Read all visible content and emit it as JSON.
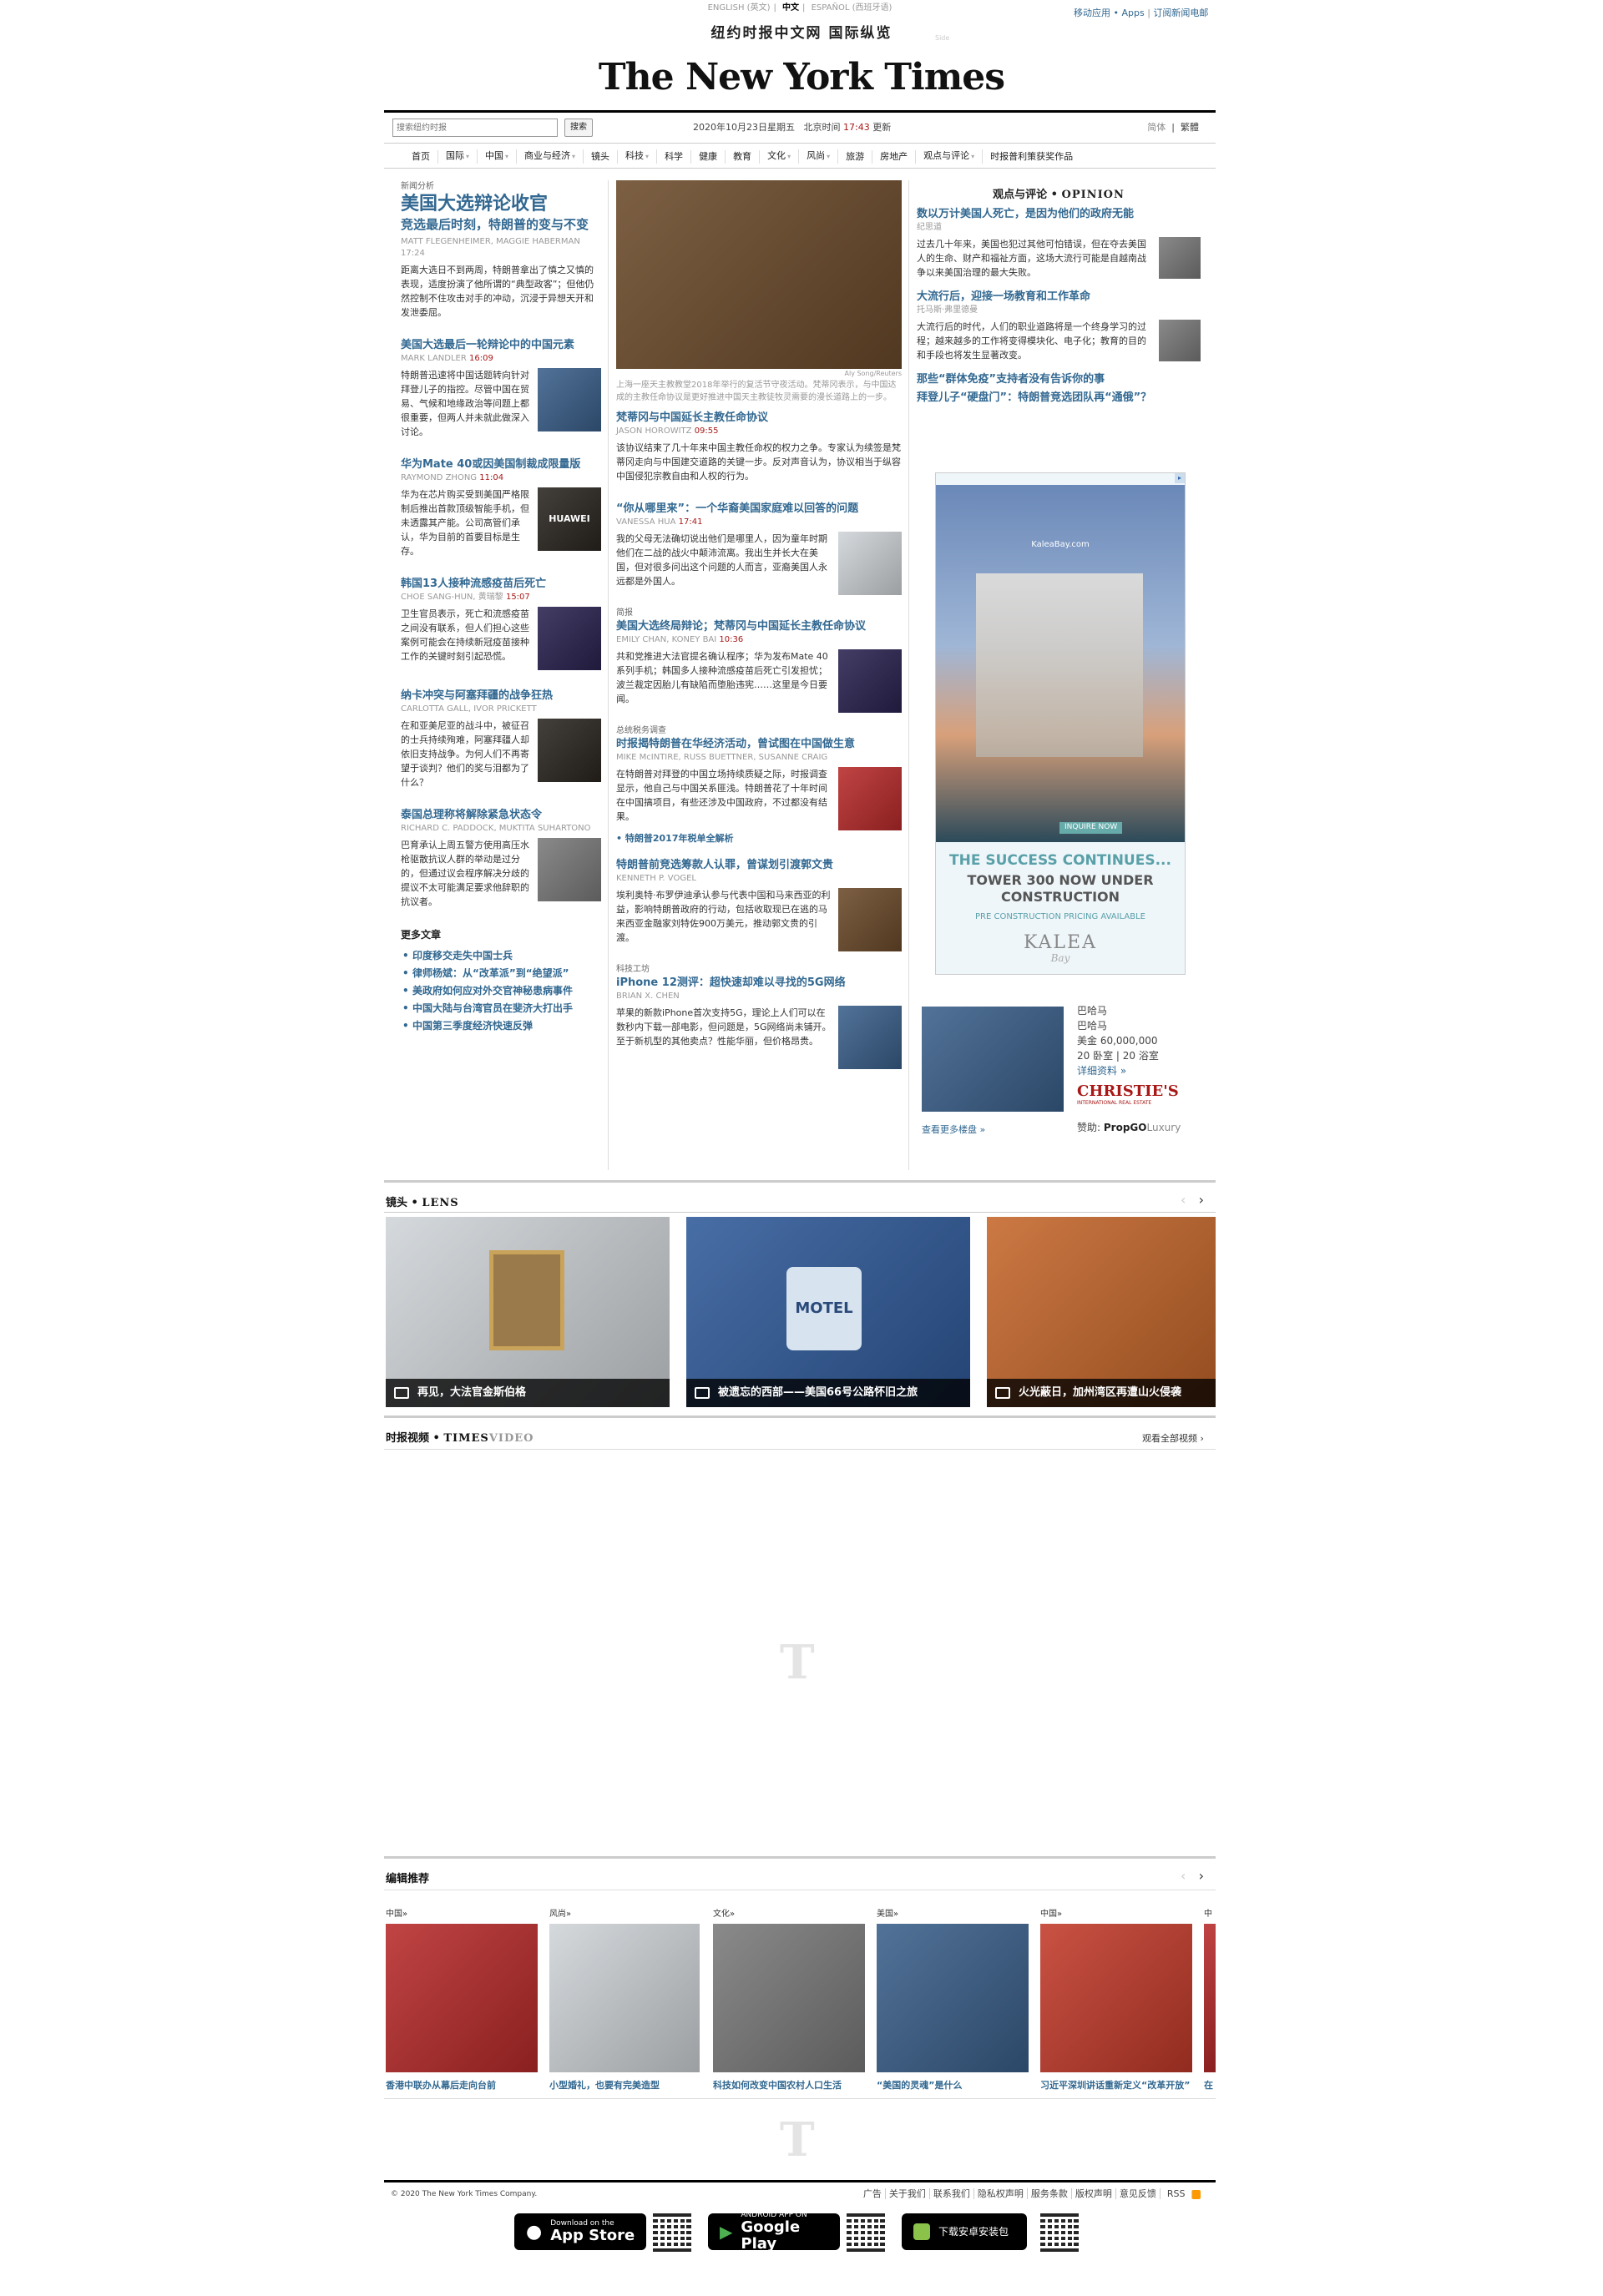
{
  "lang": {
    "english": "ENGLISH (英文)",
    "chinese": "中文",
    "spanish": "ESPAÑOL (西班牙语)"
  },
  "top_right": {
    "apps": "移动应用 • Apps",
    "sep": "|",
    "subscribe": "订阅新闻电邮"
  },
  "site_subtitle": "纽约时报中文网 国际纵览",
  "side_label": "Side",
  "logo": "The New York Times",
  "search": {
    "placeholder": "搜索纽约时报",
    "button": "搜索"
  },
  "dateline": {
    "date": "2020年10月23日星期五",
    "beijing": "北京时间",
    "time": "17:43",
    "update": "更新"
  },
  "scripts": {
    "simplified": "简体",
    "sep": "|",
    "traditional": "繁體"
  },
  "nav": [
    "首页",
    "国际",
    "中国",
    "商业与经济",
    "镜头",
    "科技",
    "科学",
    "健康",
    "教育",
    "文化",
    "风尚",
    "旅游",
    "房地产",
    "观点与评论",
    "时报普利策获奖作品"
  ],
  "col1": {
    "lead_kicker": "新闻分析",
    "lead_title": "美国大选辩论收官",
    "lead_sub": "竞选最后时刻，特朗普的变与不变",
    "lead_byline": "MATT FLEGENHEIMER, MAGGIE HABERMAN",
    "lead_time": "17:24",
    "lead_text": "距离大选日不到两周，特朗普拿出了慎之又慎的表现，适度扮演了他所谓的“典型政客”；但他仍然控制不住攻击对手的冲动，沉浸于异想天开和发泄委屈。",
    "s2": {
      "title": "美国大选最后一轮辩论中的中国元素",
      "byline": "MARK LANDLER",
      "time": "16:09",
      "text": "特朗普迅速将中国话题转向针对拜登儿子的指控。尽管中国在贸易、气候和地缘政治等问题上都很重要，但两人并未就此做深入讨论。"
    },
    "s3": {
      "title": "华为Mate 40或因美国制裁成限量版",
      "byline": "RAYMOND ZHONG",
      "time": "11:04",
      "text": "华为在芯片购买受到美国严格限制后推出首款顶级智能手机，但未透露其产能。公司高管们承认，华为目前的首要目标是生存。",
      "thumb_label": "HUAWEI"
    },
    "s4": {
      "title": "韩国13人接种流感疫苗后死亡",
      "byline": "CHOE SANG-HUN, 黄瑞黎",
      "time": "15:07",
      "text": "卫生官员表示，死亡和流感疫苗之间没有联系，但人们担心这些案例可能会在持续新冠疫苗接种工作的关键时刻引起恐慌。"
    },
    "s5": {
      "title": "纳卡冲突与阿塞拜疆的战争狂热",
      "byline": "CARLOTTA GALL, IVOR PRICKETT",
      "text": "在和亚美尼亚的战斗中，被征召的士兵持续殉难，阿塞拜疆人却依旧支持战争。为何人们不再寄望于谈判？他们的奖与泪都为了什么？"
    },
    "s6": {
      "title": "泰国总理称将解除紧急状态令",
      "byline": "RICHARD C. PADDOCK, MUKTITA SUHARTONO",
      "text": "巴育承认上周五警方使用高压水枪驱散抗议人群的举动是过分的，但通过议会程序解决分歧的提议不太可能满足要求他辞职的抗议者。"
    },
    "more_title": "更多文章",
    "more": [
      "印度移交走失中国士兵",
      "律师杨斌：从“改革派”到“绝望派”",
      "美政府如何应对外交官神秘患病事件",
      "中国大陆与台湾官员在斐济大打出手",
      "中国第三季度经济快速反弹"
    ]
  },
  "col2": {
    "photo_credit": "Aly Song/Reuters",
    "photo_caption": "上海一座天主教教堂2018年举行的复活节守夜活动。梵蒂冈表示，与中国达成的主教任命协议是更好推进中国天主教徒牧灵需要的漫长道路上的一步。",
    "s1": {
      "title": "梵蒂冈与中国延长主教任命协议",
      "byline": "JASON HOROWITZ",
      "time": "09:55",
      "text": "该协议结束了几十年来中国主教任命权的权力之争。专家认为续签是梵蒂冈走向与中国建交道路的关键一步。反对声音认为，协议相当于纵容中国侵犯宗教自由和人权的行为。"
    },
    "s2": {
      "title": "“你从哪里来”：一个华裔美国家庭难以回答的问题",
      "byline": "VANESSA HUA",
      "time": "17:41",
      "text": "我的父母无法确切说出他们是哪里人，因为童年时期他们在二战的战火中颠沛流离。我出生并长大在美国，但对很多问出这个问题的人而言，亚裔美国人永远都是外国人。"
    },
    "s3": {
      "kicker": "简报",
      "title": "美国大选终局辩论；梵蒂冈与中国延长主教任命协议",
      "byline": "EMILY CHAN, KONEY BAI",
      "time": "10:36",
      "text": "共和党推进大法官提名确认程序；华为发布Mate 40系列手机；韩国多人接种流感疫苗后死亡引发担忧；波兰裁定因胎儿有缺陷而堕胎违宪……这里是今日要闻。"
    },
    "s4": {
      "kicker": "总统税务调查",
      "title": "时报揭特朗普在华经济活动，曾试图在中国做生意",
      "byline": "MIKE McINTIRE, RUSS BUETTNER, SUSANNE CRAIG",
      "text": "在特朗普对拜登的中国立场持续质疑之际，时报调查显示，他自己与中国关系匪浅。特朗普花了十年时间在中国搞项目，有些还涉及中国政府，不过都没有结果。",
      "link": "特朗普2017年税单全解析"
    },
    "s5": {
      "title": "特朗普前竞选筹款人认罪，曾谋划引渡郭文贵",
      "byline": "KENNETH P. VOGEL",
      "text": "埃利奥特·布罗伊迪承认参与代表中国和马来西亚的利益，影响特朗普政府的行动，包括收取现已在逃的马来西亚金融家刘特佐900万美元，推动郭文贵的引渡。"
    },
    "s6": {
      "kicker": "科技工坊",
      "title": "iPhone 12测评：超快速却难以寻找的5G网络",
      "byline": "BRIAN X. CHEN",
      "text": "苹果的新款iPhone首次支持5G，理论上人们可以在数秒内下载一部电影，但问题是，5G网络尚未铺开。至于新机型的其他卖点？性能华丽，但价格昂贵。"
    }
  },
  "col3": {
    "opinion_label": "观点与评论 • ",
    "opinion_sub": "OPINION",
    "s1": {
      "title": "数以万计美国人死亡，是因为他们的政府无能",
      "byline": "纪思道",
      "text": "过去几十年来，美国也犯过其他可怕错误，但在夺去美国人的生命、财产和福祉方面，这场大流行可能是自越南战争以来美国治理的最大失败。"
    },
    "s2": {
      "title": "大流行后，迎接一场教育和工作革命",
      "byline": "托马斯·弗里德曼",
      "text": "大流行后的时代，人们的职业道路将是一个终身学习的过程；越来越多的工作将变得模块化、电子化；教育的目的和手段也将发生显著改变。"
    },
    "s3": {
      "title": "那些“群体免疫”支持者没有告诉你的事"
    },
    "s4": {
      "title": "拜登儿子“硬盘门”：特朗普竞选团队再“通俄”？"
    },
    "ad": {
      "site": "KaleaBay.com",
      "cta": "INQUIRE NOW",
      "l1": "THE SUCCESS CONTINUES...",
      "l2": "TOWER 300  NOW UNDER",
      "l3": "CONSTRUCTION",
      "l4": "PRE CONSTRUCTION  PRICING AVAILABLE",
      "brand": "KALEA",
      "brand_sub": "Bay"
    },
    "listing": {
      "l1": "巴哈马",
      "l2": "巴哈马",
      "price": "美金 60,000,000",
      "rooms": "20 卧室 | 20 浴室",
      "detail": "详细资料 »",
      "brand": "CHRISTIE'S",
      "brand_sub": "INTERNATIONAL REAL ESTATE",
      "more": "查看更多楼盘 »",
      "sponsor_label": "赞助:",
      "sponsor": "PropGO",
      "sponsor2": "Luxury"
    }
  },
  "lens": {
    "label": "镜头 • ",
    "sub": "LENS",
    "items": [
      "再见，大法官金斯伯格",
      "被遗忘的西部——美国66号公路怀旧之旅",
      "火光蔽日，加州湾区再遭山火侵袭"
    ],
    "motel": "MOTEL"
  },
  "video": {
    "label": "时报视频 • ",
    "sub": "TIMES",
    "sub2": "VIDEO",
    "all": "观看全部视频"
  },
  "editors": {
    "label": "编辑推荐",
    "items": [
      {
        "cat": "中国»",
        "cap": "香港中联办从幕后走向台前"
      },
      {
        "cat": "风尚»",
        "cap": "小型婚礼，也要有完美造型"
      },
      {
        "cat": "文化»",
        "cap": "科技如何改变中国农村人口生活"
      },
      {
        "cat": "美国»",
        "cap": "“美国的灵魂”是什么"
      },
      {
        "cat": "中国»",
        "cap": "习近平深圳讲话重新定义“改革开放”"
      }
    ],
    "overflow_cat": "中",
    "overflow_cap": "在"
  },
  "footer": {
    "copyright": "© 2020 The New York Times Company.",
    "links": [
      "广告",
      "关于我们",
      "联系我们",
      "隐私权声明",
      "服务条款",
      "版权声明",
      "意见反馈",
      "RSS"
    ]
  },
  "apps": {
    "ios_small": "Download on the",
    "ios_big": "App Store",
    "android_small": "ANDROID APP ON",
    "android_big": "Google Play",
    "apk": "下载安卓安装包"
  }
}
